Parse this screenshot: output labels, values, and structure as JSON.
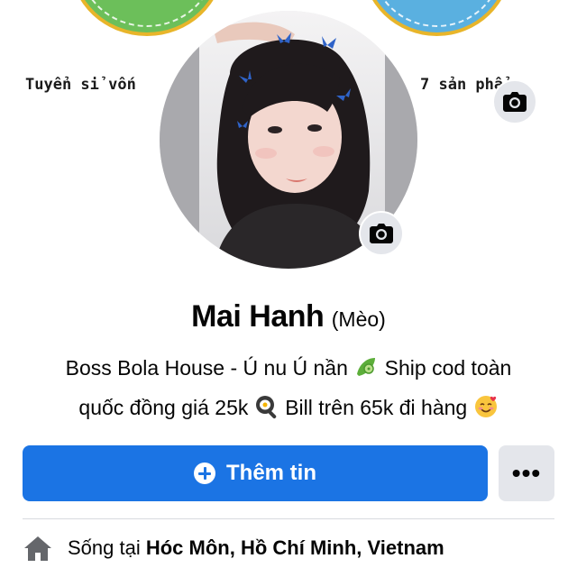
{
  "cover": {
    "text_left": "Tuyển sỉ vốn",
    "text_right": "7 sản phẩ"
  },
  "profile": {
    "name": "Mai Hanh",
    "nickname": "(Mèo)",
    "bio_line1": "Boss Bola House - Ú nu Ú nần",
    "bio_line1_tail": "Ship cod toàn",
    "bio_line2_a": "quốc đồng giá 25k",
    "bio_line2_b": "Bill trên 65k đi hàng"
  },
  "actions": {
    "add_story_label": "Thêm tin",
    "more_label": "•••"
  },
  "details": {
    "lives_prefix": "Sống tại",
    "lives_place": "Hóc Môn, Hồ Chí Minh, Vietnam"
  },
  "colors": {
    "primary_button": "#1b74e4",
    "secondary_button": "#e4e6eb",
    "text": "#050505"
  },
  "icons": {
    "cover_camera": "camera-icon",
    "avatar_camera": "camera-icon",
    "plus": "plus-circle-icon",
    "home": "home-icon"
  }
}
